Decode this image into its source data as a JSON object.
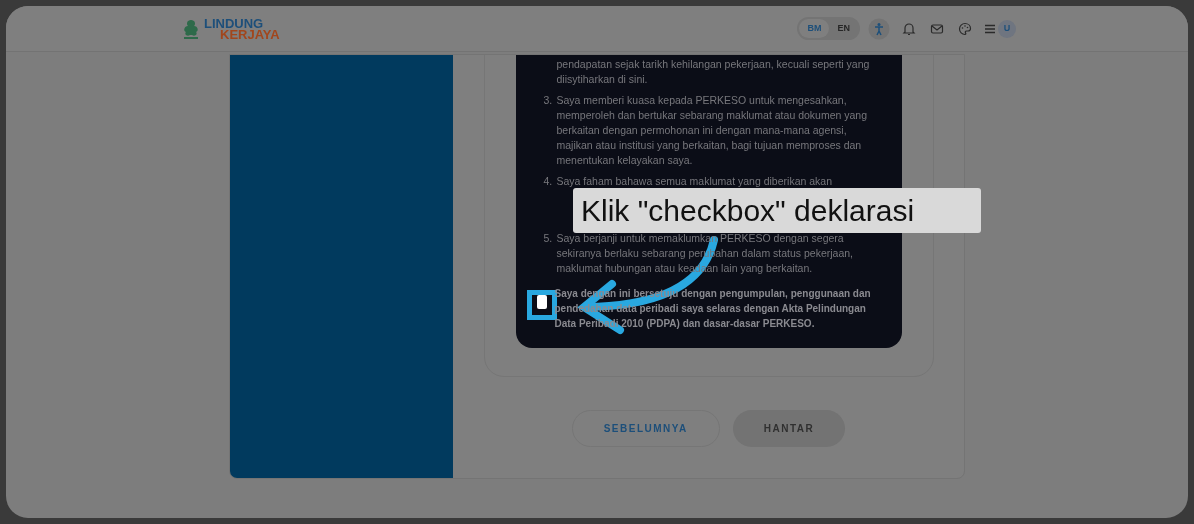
{
  "header": {
    "logo": {
      "line_1": "LINDUNG",
      "line_2": "KERJAYA"
    },
    "languages": [
      {
        "label": "BM",
        "selected": true
      },
      {
        "label": "EN",
        "selected": false
      }
    ],
    "avatar": "U"
  },
  "declaration_list": [
    {
      "text": "pendapatan sejak tarikh kehilangan pekerjaan, kecuali seperti yang diisytiharkan di sini.",
      "kind": "partial"
    },
    {
      "number": "3.",
      "text": "Saya memberi kuasa kepada PERKESO untuk mengesahkan, memperoleh dan bertukar sebarang maklumat atau dokumen yang berkaitan dengan permohonan ini dengan mana-mana agensi, majikan atau institusi yang berkaitan, bagi tujuan memproses dan menentukan kelayakan saya.",
      "kind": "full"
    },
    {
      "number": "4.",
      "text": "Saya faham bahawa semua maklumat yang diberikan akan",
      "kind": "covered"
    },
    {
      "number": "5.",
      "text": "Saya berjanji untuk memaklumkan PERKESO dengan segera sekiranya berlaku sebarang perubahan dalam status pekerjaan, maklumat hubungan atau keadaan lain yang berkaitan.",
      "kind": "full"
    }
  ],
  "consent": {
    "checked": false,
    "text": "Saya dengan ini bersetuju dengan pengumpulan, penggunaan dan pendedahan data peribadi saya selaras dengan Akta Pelindungan Data Peribadi 2010 (PDPA) dan dasar-dasar PERKESO."
  },
  "buttons": [
    {
      "label": "SEBELUMNYA",
      "disabled": false
    },
    {
      "label": "HANTAR",
      "disabled": true
    }
  ],
  "tooltip": "Klik \"checkbox\" deklarasi"
}
